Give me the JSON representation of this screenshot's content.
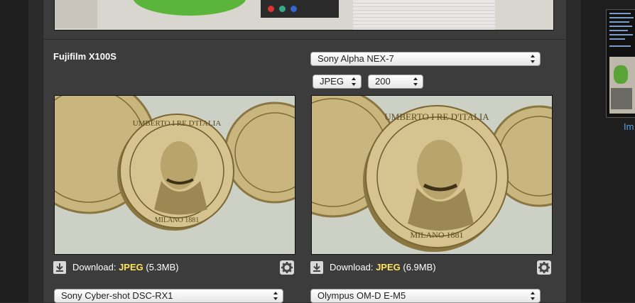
{
  "left_camera": {
    "title": "Fujifilm X100S",
    "download_label": "Download:",
    "format": "JPEG",
    "size": "(5.3MB)",
    "next_select": "Sony Cyber-shot DSC-RX1"
  },
  "right_camera": {
    "select": "Sony Alpha NEX-7",
    "format_select": "JPEG",
    "iso_select": "200",
    "download_label": "Download:",
    "format": "JPEG",
    "size": "(6.9MB)",
    "next_select": "Olympus OM-D E-M5"
  },
  "sidebar": {
    "caption": "Im"
  },
  "colors": {
    "page_bg": "#2b2b2b",
    "panel_bg": "#3c3c3c",
    "format_highlight": "#ffe55c",
    "link": "#5aa0e6"
  },
  "icons": [
    "download-icon",
    "gear-icon",
    "select-arrows-icon"
  ]
}
